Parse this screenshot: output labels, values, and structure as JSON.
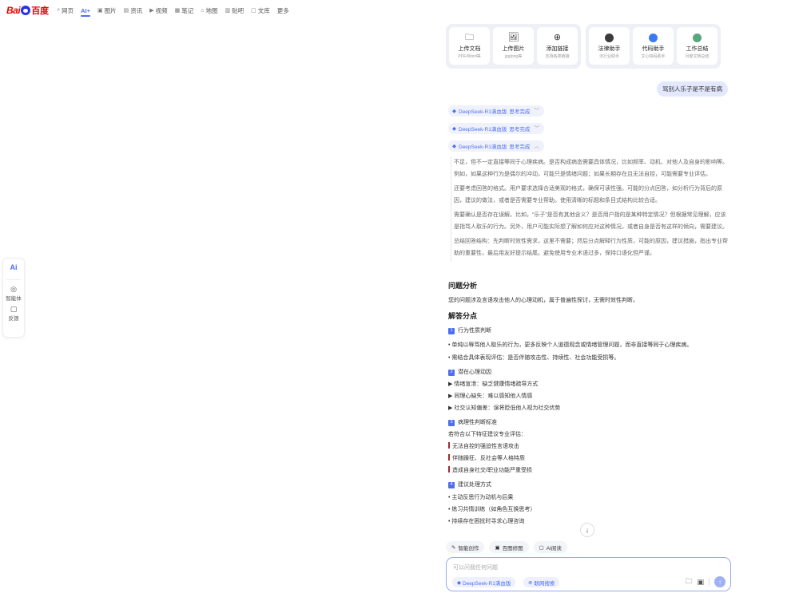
{
  "nav": {
    "logo_text": "Bai",
    "logo_cn": "百度",
    "items": [
      {
        "icon": "⌕",
        "label": "网页"
      },
      {
        "icon": "",
        "label": "AI+"
      },
      {
        "icon": "▣",
        "label": "图片"
      },
      {
        "icon": "▤",
        "label": "资讯"
      },
      {
        "icon": "▶",
        "label": "视频"
      },
      {
        "icon": "▦",
        "label": "笔记"
      },
      {
        "icon": "⌂",
        "label": "地图"
      },
      {
        "icon": "▥",
        "label": "贴吧"
      },
      {
        "icon": "▢",
        "label": "文库"
      },
      {
        "icon": "",
        "label": "更多"
      }
    ]
  },
  "side": {
    "ai_label": "Ai",
    "agent_label": "智能体",
    "feedback_label": "反馈"
  },
  "tools": {
    "left": [
      {
        "icon": "folder-icon",
        "glyph": "🗀",
        "title": "上传文档",
        "sub": "PDF/Word等"
      },
      {
        "icon": "image-icon",
        "glyph": "🖼",
        "title": "上传图片",
        "sub": "jpg/png等"
      },
      {
        "icon": "globe-icon",
        "glyph": "⊕",
        "title": "添加链接",
        "sub": "支持各类链接"
      }
    ],
    "right": [
      {
        "icon": "lawyer-avatar-icon",
        "title": "法律助手",
        "sub": "法行业助手",
        "color": "#3b3b3b"
      },
      {
        "icon": "code-avatar-icon",
        "title": "代码助手",
        "sub": "文心快码助手",
        "color": "#3a7bf0"
      },
      {
        "icon": "work-avatar-icon",
        "title": "工作总结",
        "sub": "月度文档总结",
        "color": "#57a77d"
      }
    ]
  },
  "chat": {
    "user_message": "骂别人乐子是不是有病",
    "thinking_pills": [
      {
        "model": "DeepSeek-R1满血版",
        "status": "思考完成",
        "chevron": "﹀"
      },
      {
        "model": "DeepSeek-R1满血版",
        "status": "思考完成",
        "chevron": "﹀"
      },
      {
        "model": "DeepSeek-R1满血版",
        "status": "思考完成",
        "chevron": "︿"
      }
    ],
    "thinking": [
      "不足，但不一定直接等同于心理疾病。是否构成病态需要具体情况，比如频率、动机、对他人及自身的影响等。例如，如果这种行为是偶尔的冲动，可能只是情绪问题；如果长期存在且无法自控，可能需要专业评估。",
      "还要考虑回答的格式。用户要求选择合适美观的格式，确保可读性强。可能的分点回答，如分析行为背后的原因，建议的做法，或者是否需要专业帮助。使用清晰的标题和条目式结构比较合适。",
      "需要确认是否存在误解。比如，“乐子”是否有其他含义？是否用户指的是某种特定情况？但根据常见理解，应该是指骂人取乐的行为。另外，用户可能实际想了解如何应对这种情况，或者自身是否有这样的倾向，需要建议。",
      "总结回答结构：先判断时效性需求，这里不需要；然后分点解释行为性质，可能的原因，建议措施，指出专业帮助的重要性，最后用友好提示结尾。避免使用专业术语过多，保持口语化但严谨。"
    ],
    "answer": {
      "h1": "问题分析",
      "intro": "您的问题涉及言语攻击他人的心理动机，属于普遍性探讨，无需时效性判断。",
      "h2": "解答分点",
      "s1_num": "1",
      "s1_title": "行为性质判断",
      "s1_b1": "• 单纯以辱骂他人取乐的行为，更多反映个人道德观念或情绪管理问题，而非直接等同于心理疾病。",
      "s1_b2": "• 需结合具体表现评估：是否伴随攻击性、持续性、社会功能受损等。",
      "s2_num": "2",
      "s2_title": "潜在心理动因",
      "s2_items": [
        "▶ 情绪宣泄：缺乏健康情绪疏导方式",
        "▶ 同理心缺失：难以感知他人情感",
        "▶ 社交认知偏差：误将贬低他人视为社交优势"
      ],
      "s3_num": "3",
      "s3_title": "病理性判断标准",
      "s3_intro": "若符合以下特征建议专业评估：",
      "s3_items": [
        "无法自控的强迫性言语攻击",
        "伴随躁狂、反社会等人格特质",
        "造成自身社交/职业功能严重受损"
      ],
      "s4_num": "4",
      "s4_title": "建议处理方式",
      "s4_items": [
        "• 主动反思行为动机与后果",
        "• 练习共情训练（如角色互换思考）",
        "• 持续存在困扰时寻求心理咨询"
      ]
    }
  },
  "chips": [
    {
      "icon": "✎",
      "label": "智能创作"
    },
    {
      "icon": "▣",
      "label": "百图修图"
    },
    {
      "icon": "▢",
      "label": "AI阅读"
    }
  ],
  "input": {
    "placeholder": "可以问我任何问题",
    "model_label": "DeepSeek-R1满血版",
    "net_label": "联网搜索"
  }
}
